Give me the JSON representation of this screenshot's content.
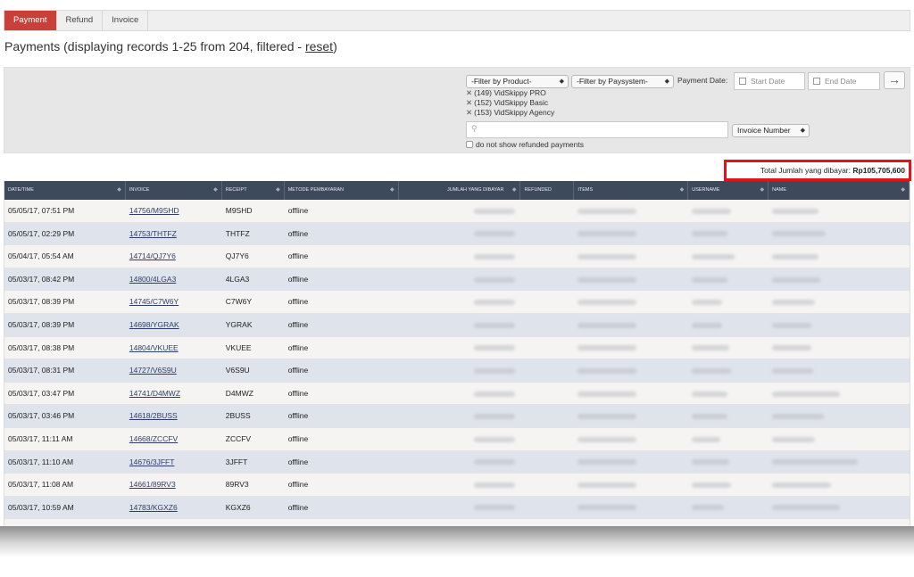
{
  "tabs": [
    {
      "label": "Payment",
      "active": true
    },
    {
      "label": "Refund",
      "active": false
    },
    {
      "label": "Invoice",
      "active": false
    }
  ],
  "title": {
    "text": "Payments (displaying records 1-25 from 204, filtered - ",
    "reset_link": "reset",
    "close": ")"
  },
  "filters": {
    "product_select": "-Filter by Product-",
    "paysystem_select": "-Filter by Paysystem-",
    "payment_date_label": "Payment Date:",
    "start_date_placeholder": "Start Date",
    "end_date_placeholder": "End Date",
    "selected_products": [
      "(149) VidSkippy PRO",
      "(152) VidSkippy Basic",
      "(153) VidSkippy Agency"
    ],
    "invoice_field_select": "Invoice Number",
    "refund_checkbox_label": "do not show refunded payments",
    "go_arrow": "→"
  },
  "total": {
    "label": "Total Jumlah yang dibayar:",
    "value": "Rp105,705,600"
  },
  "table": {
    "headers": [
      "Date/Time",
      "Invoice",
      "Receipt",
      "Metode Pembayaran",
      "Jumlah yang dibayar",
      "Refunded",
      "Items",
      "Username",
      "Name"
    ],
    "rows": [
      {
        "date": "05/05/17, 07:51 PM",
        "invoice": "14756/M9SHD",
        "receipt": "M9SHD",
        "method": "offline"
      },
      {
        "date": "05/05/17, 02:29 PM",
        "invoice": "14753/THTFZ",
        "receipt": "THTFZ",
        "method": "offline"
      },
      {
        "date": "05/04/17, 05:54 AM",
        "invoice": "14714/QJ7Y6",
        "receipt": "QJ7Y6",
        "method": "offline"
      },
      {
        "date": "05/03/17, 08:42 PM",
        "invoice": "14800/4LGA3",
        "receipt": "4LGA3",
        "method": "offline"
      },
      {
        "date": "05/03/17, 08:39 PM",
        "invoice": "14745/C7W6Y",
        "receipt": "C7W6Y",
        "method": "offline"
      },
      {
        "date": "05/03/17, 08:39 PM",
        "invoice": "14698/YGRAK",
        "receipt": "YGRAK",
        "method": "offline"
      },
      {
        "date": "05/03/17, 08:38 PM",
        "invoice": "14804/VKUEE",
        "receipt": "VKUEE",
        "method": "offline"
      },
      {
        "date": "05/03/17, 08:31 PM",
        "invoice": "14727/V6S9U",
        "receipt": "V6S9U",
        "method": "offline"
      },
      {
        "date": "05/03/17, 03:47 PM",
        "invoice": "14741/D4MWZ",
        "receipt": "D4MWZ",
        "method": "offline"
      },
      {
        "date": "05/03/17, 03:46 PM",
        "invoice": "14618/2BUSS",
        "receipt": "2BUSS",
        "method": "offline"
      },
      {
        "date": "05/03/17, 11:11 AM",
        "invoice": "14668/ZCCFV",
        "receipt": "ZCCFV",
        "method": "offline"
      },
      {
        "date": "05/03/17, 11:10 AM",
        "invoice": "14676/3JFFT",
        "receipt": "3JFFT",
        "method": "offline"
      },
      {
        "date": "05/03/17, 11:08 AM",
        "invoice": "14661/89RV3",
        "receipt": "89RV3",
        "method": "offline"
      },
      {
        "date": "05/03/17, 10:59 AM",
        "invoice": "14783/KGXZ6",
        "receipt": "KGXZ6",
        "method": "offline"
      }
    ]
  }
}
